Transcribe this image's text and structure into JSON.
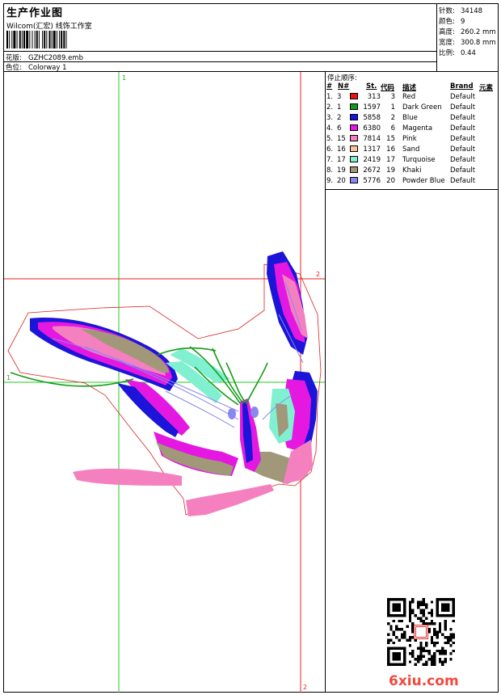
{
  "header": {
    "title": "生产作业图",
    "company": "Wilcom(汇宏) 线饰工作室",
    "design_label": "花版:",
    "design_value": "GZHC2089.emb",
    "colorway_label": "色位:",
    "colorway_value": "Colorway 1"
  },
  "stats": [
    {
      "label": "针数:",
      "value": "34148"
    },
    {
      "label": "颜色:",
      "value": "9"
    },
    {
      "label": "高度:",
      "value": "260.2 mm"
    },
    {
      "label": "宽度:",
      "value": "300.8 mm"
    },
    {
      "label": "比例:",
      "value": "0.44"
    }
  ],
  "stop_sequence": {
    "title": "停止顺序:",
    "headers": {
      "num": "#",
      "needle": "N#",
      "st": "St.",
      "code": "代码",
      "desc": "描述",
      "brand": "Brand",
      "element": "元素"
    },
    "rows": [
      {
        "num": "1.",
        "needle": "3",
        "color": "#e8141c",
        "st": "313",
        "code": "3",
        "desc": "Red",
        "brand": "Default"
      },
      {
        "num": "2.",
        "needle": "1",
        "color": "#139c18",
        "st": "1597",
        "code": "1",
        "desc": "Dark Green",
        "brand": "Default"
      },
      {
        "num": "3.",
        "needle": "2",
        "color": "#1c14d8",
        "st": "5858",
        "code": "2",
        "desc": "Blue",
        "brand": "Default"
      },
      {
        "num": "4.",
        "needle": "6",
        "color": "#e418e0",
        "st": "6380",
        "code": "6",
        "desc": "Magenta",
        "brand": "Default"
      },
      {
        "num": "5.",
        "needle": "15",
        "color": "#f580c0",
        "st": "7814",
        "code": "15",
        "desc": "Pink",
        "brand": "Default"
      },
      {
        "num": "6.",
        "needle": "16",
        "color": "#f8c498",
        "st": "1317",
        "code": "16",
        "desc": "Sand",
        "brand": "Default"
      },
      {
        "num": "7.",
        "needle": "17",
        "color": "#80f0d0",
        "st": "2419",
        "code": "17",
        "desc": "Turquoise",
        "brand": "Default"
      },
      {
        "num": "8.",
        "needle": "19",
        "color": "#a09878",
        "st": "2672",
        "code": "19",
        "desc": "Khaki",
        "brand": "Default"
      },
      {
        "num": "9.",
        "needle": "20",
        "color": "#8888f0",
        "st": "5776",
        "code": "20",
        "desc": "Powder Blue",
        "brand": "Default"
      }
    ]
  },
  "guides": {
    "green_label": "1",
    "red_label": "2"
  },
  "watermark": "6xiu.com"
}
